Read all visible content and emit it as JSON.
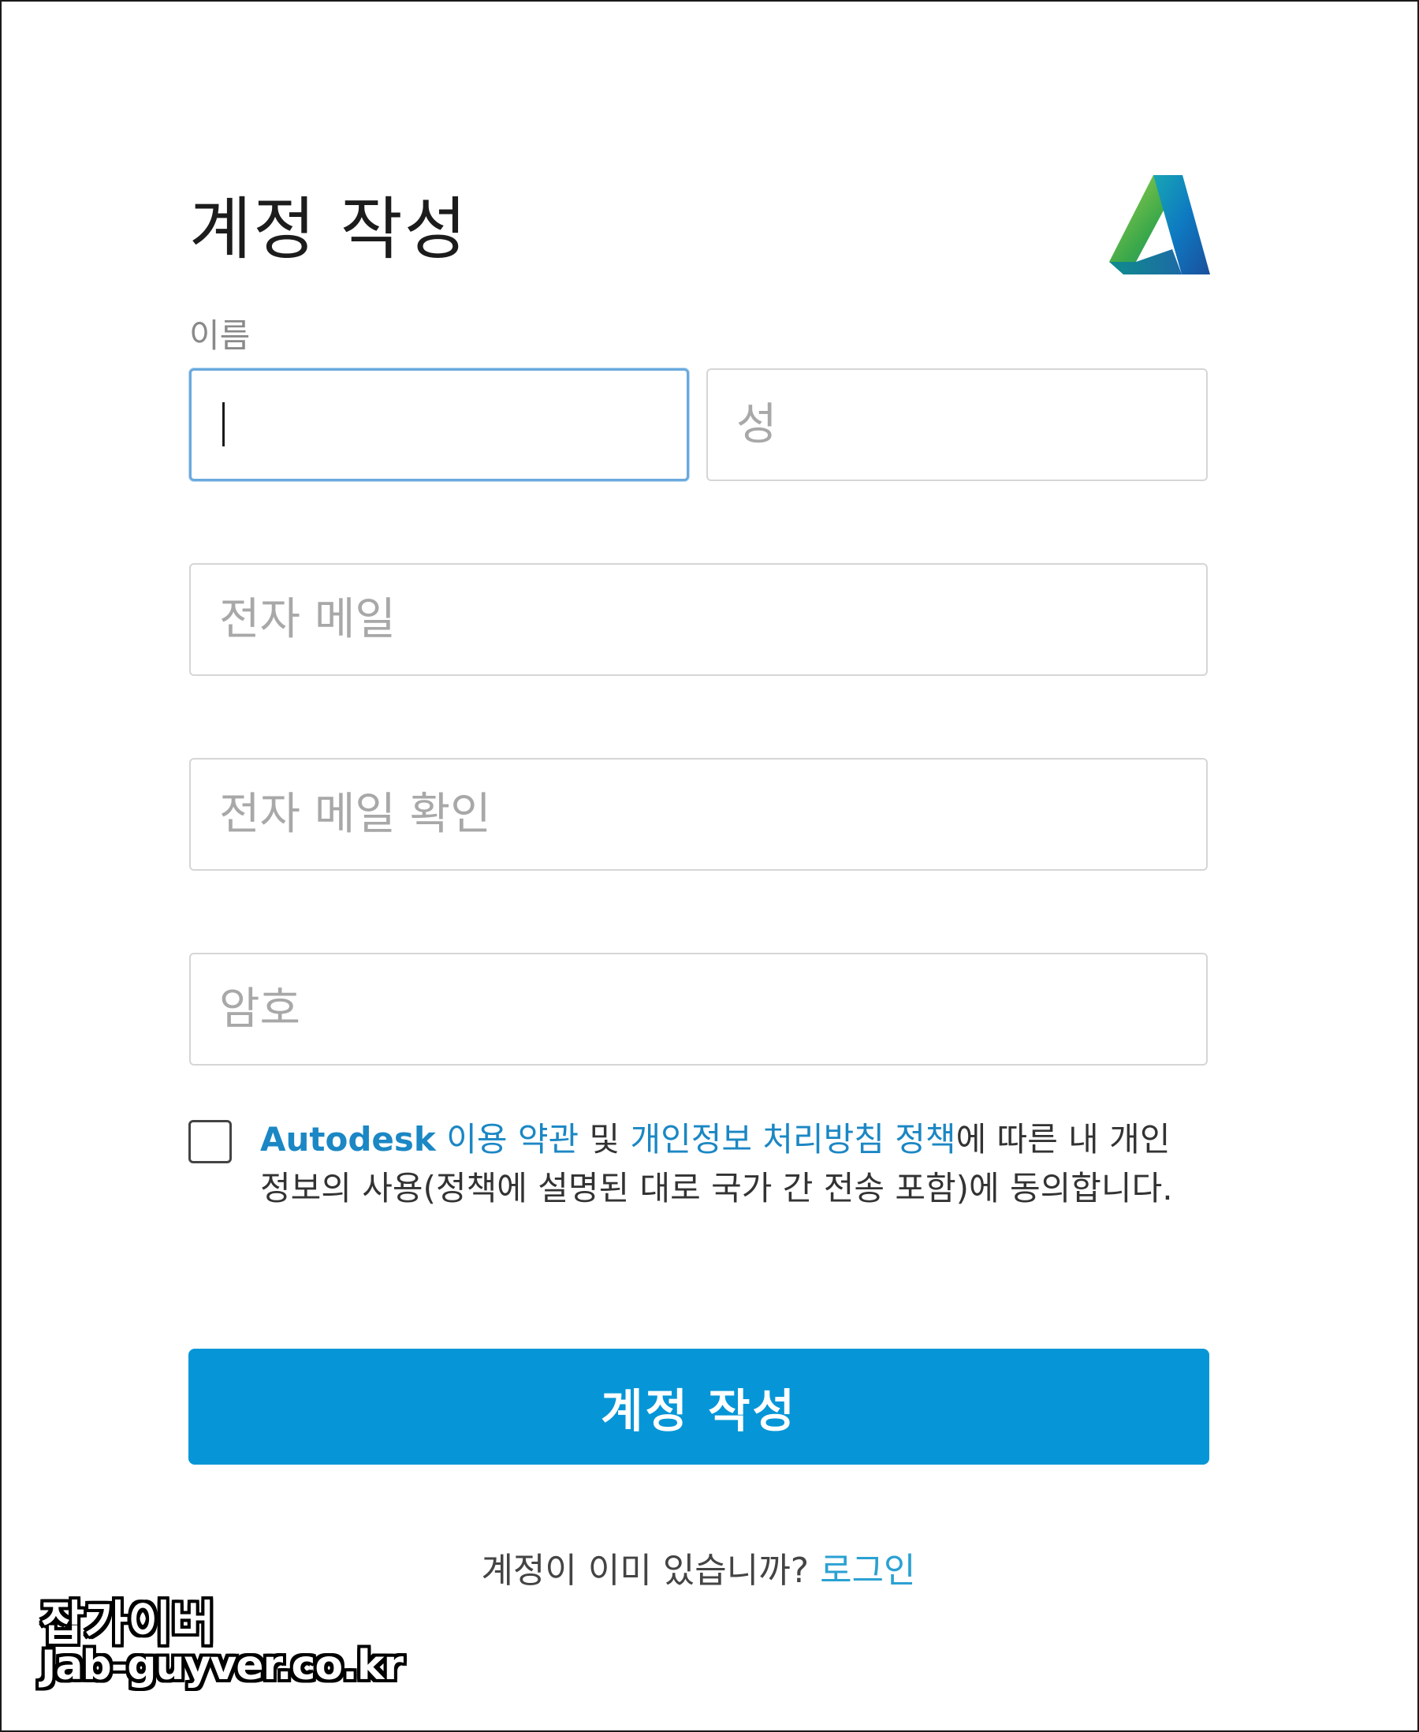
{
  "form": {
    "title": "계정 작성",
    "name_label": "이름",
    "first_name": {
      "value": "",
      "placeholder": ""
    },
    "last_name": {
      "value": "",
      "placeholder": "성"
    },
    "email": {
      "placeholder": "전자 메일"
    },
    "email_confirm": {
      "placeholder": "전자 메일 확인"
    },
    "password": {
      "placeholder": "암호"
    },
    "consent": {
      "checked": false,
      "brand": "Autodesk",
      "terms_link": "이용 약관",
      "and": " 및 ",
      "privacy_link": "개인정보 처리방침 정책",
      "rest": "에 따른 내 개인 정보의 사용(정책에 설명된 대로 국가 간 전송 포함)에 동의합니다."
    },
    "submit_label": "계정 작성",
    "signin_prompt": "계정이 이미 있습니까? ",
    "signin_link": "로그인"
  },
  "logo": {
    "icon": "autodesk-logo-icon",
    "colors": {
      "green": "#87c540",
      "teal": "#1aa3a0",
      "blue": "#0e74bc",
      "dark_blue": "#1b4f9c"
    }
  },
  "watermark": {
    "name": "잡가이버",
    "url": "Jab-guyver.co.kr"
  },
  "colors": {
    "accent": "#0696d7",
    "link": "#1b87c4",
    "focus_border": "#6aa9dd"
  }
}
